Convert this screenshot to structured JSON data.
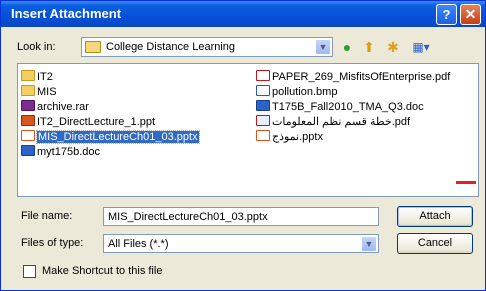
{
  "window": {
    "title": "Insert Attachment",
    "help_glyph": "?",
    "close_glyph": "✕"
  },
  "toolbar": {
    "look_in_label": "Look in:",
    "look_in_value": "College Distance Learning",
    "dropdown_glyph": "▼",
    "back_glyph": "●",
    "up_glyph": "⬆",
    "new_folder_glyph": "✱",
    "views_glyph": "▦▾",
    "icons": [
      "back-icon",
      "up-folder-icon",
      "new-folder-icon",
      "views-menu-icon"
    ]
  },
  "files": {
    "left": [
      {
        "name": "IT2",
        "icon": "folder-icon"
      },
      {
        "name": "MIS",
        "icon": "folder-icon"
      },
      {
        "name": "archive.rar",
        "icon": "rar-file-icon"
      },
      {
        "name": "IT2_DirectLecture_1.ppt",
        "icon": "ppt-file-icon"
      },
      {
        "name": "MIS_DirectLectureCh01_03.pptx",
        "icon": "pptx-file-icon",
        "selected": true
      },
      {
        "name": "myt175b.doc",
        "icon": "doc-file-icon"
      }
    ],
    "right": [
      {
        "name": "PAPER_269_MisfitsOfEnterprise.pdf",
        "icon": "pdf-file-icon"
      },
      {
        "name": "pollution.bmp",
        "icon": "bmp-file-icon"
      },
      {
        "name": "T175B_Fall2010_TMA_Q3.doc",
        "icon": "doc-file-icon"
      },
      {
        "name": "خطة قسم نظم المعلومات.pdf",
        "icon": "pdf-file-icon"
      },
      {
        "name": "نموذج.pptx",
        "icon": "pptx-file-icon"
      }
    ]
  },
  "form": {
    "file_name_label": "File name:",
    "file_name_value": "MIS_DirectLectureCh01_03.pptx",
    "files_of_type_label": "Files of type:",
    "files_of_type_value": "All Files (*.*)",
    "shortcut_label": "Make Shortcut to this file",
    "shortcut_checked": false
  },
  "buttons": {
    "attach": "Attach",
    "cancel": "Cancel"
  }
}
